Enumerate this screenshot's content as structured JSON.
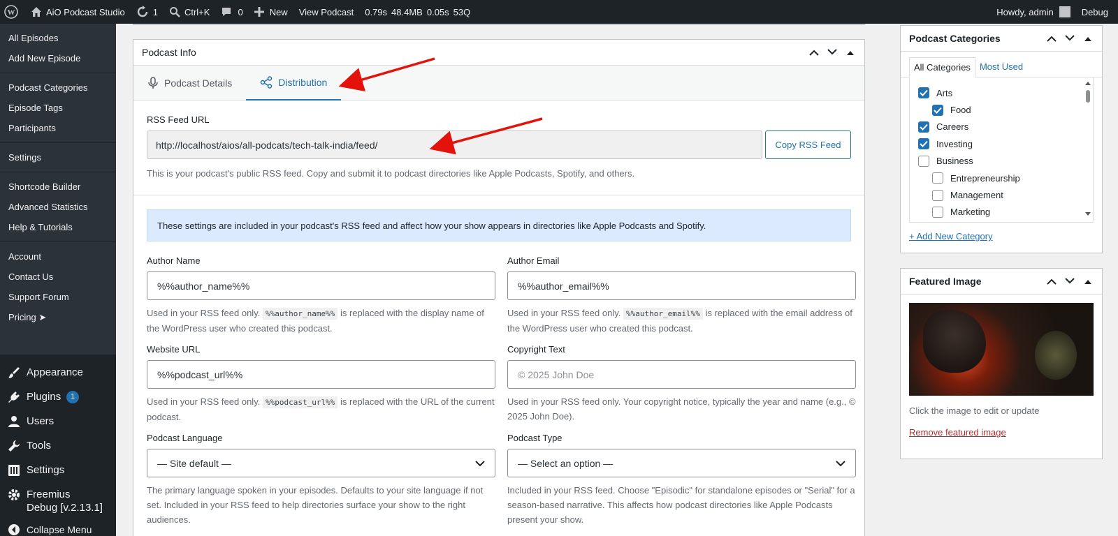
{
  "adminbar": {
    "site_name": "AiO Podcast Studio",
    "updates_count": "1",
    "search_shortcut": "Ctrl+K",
    "comments_count": "0",
    "new_label": "New",
    "view_label": "View Podcast",
    "perf_time": "0.79s",
    "perf_mem": "48.4MB",
    "perf_db": "0.05s",
    "perf_queries": "53Q",
    "howdy": "Howdy, admin",
    "debug": "Debug"
  },
  "sidebar": {
    "group1": [
      "All Episodes",
      "Add New Episode"
    ],
    "group2": [
      "Podcast Categories",
      "Episode Tags",
      "Participants"
    ],
    "group3": [
      "Settings"
    ],
    "group4": [
      "Shortcode Builder",
      "Advanced Statistics",
      "Help & Tutorials"
    ],
    "group5": [
      "Account",
      "Contact Us",
      "Support Forum",
      "Pricing ➤"
    ],
    "menu": {
      "appearance": "Appearance",
      "plugins": "Plugins",
      "plugins_badge": "1",
      "users": "Users",
      "tools": "Tools",
      "settings": "Settings",
      "freemius": "Freemius Debug [v.2.13.1]",
      "collapse": "Collapse Menu"
    }
  },
  "postbox": {
    "title": "Podcast Info",
    "tabs": [
      "Podcast Details",
      "Distribution"
    ],
    "rss_label": "RSS Feed URL",
    "rss_value": "http://localhost/aios/all-podcats/tech-talk-india/feed/",
    "copy_button": "Copy RSS Feed",
    "rss_hint": "This is your podcast's public RSS feed. Copy and submit it to podcast directories like Apple Podcasts, Spotify, and others.",
    "notice": "These settings are included in your podcast's RSS feed and affect how your show appears in directories like Apple Podcasts and Spotify.",
    "author_name": {
      "label": "Author Name",
      "value": "%%author_name%%",
      "hint_a": "Used in your RSS feed only.",
      "code": "%%author_name%%",
      "hint_b": "is replaced with the display name of the WordPress user who created this podcast."
    },
    "author_email": {
      "label": "Author Email",
      "value": "%%author_email%%",
      "hint_a": "Used in your RSS feed only.",
      "code": "%%author_email%%",
      "hint_b": "is replaced with the email address of the WordPress user who created this podcast."
    },
    "website_url": {
      "label": "Website URL",
      "value": "%%podcast_url%%",
      "hint_a": "Used in your RSS feed only.",
      "code": "%%podcast_url%%",
      "hint_b": "is replaced with the URL of the current podcast."
    },
    "copyright": {
      "label": "Copyright Text",
      "placeholder": "© 2025 John Doe",
      "hint": "Used in your RSS feed only. Your copyright notice, typically the year and name (e.g., © 2025 John Doe)."
    },
    "language": {
      "label": "Podcast Language",
      "value": "— Site default —",
      "hint": "The primary language spoken in your episodes. Defaults to your site language if not set. Included in your RSS feed to help directories surface your show to the right audiences."
    },
    "type": {
      "label": "Podcast Type",
      "value": "— Select an option —",
      "hint": "Included in your RSS feed. Choose \"Episodic\" for standalone episodes or \"Serial\" for a season-based narrative. This affects how podcast directories like Apple Podcasts present your show."
    }
  },
  "categories_box": {
    "title": "Podcast Categories",
    "tab_all": "All Categories",
    "tab_used": "Most Used",
    "items": [
      {
        "label": "Arts",
        "checked": true,
        "child": false
      },
      {
        "label": "Food",
        "checked": true,
        "child": true
      },
      {
        "label": "Careers",
        "checked": true,
        "child": false
      },
      {
        "label": "Investing",
        "checked": true,
        "child": false
      },
      {
        "label": "Business",
        "checked": false,
        "child": false
      },
      {
        "label": "Entrepreneurship",
        "checked": false,
        "child": true
      },
      {
        "label": "Management",
        "checked": false,
        "child": true
      },
      {
        "label": "Marketing",
        "checked": false,
        "child": true
      }
    ],
    "add_new": "+ Add New Category"
  },
  "featured_box": {
    "title": "Featured Image",
    "note": "Click the image to edit or update",
    "remove": "Remove featured image"
  },
  "colors": {
    "accent": "#2271b1",
    "adminbar": "#1d2327",
    "sidebar": "#2c3338",
    "notice_bg": "#dbeafe",
    "arrow": "#e3120b"
  }
}
